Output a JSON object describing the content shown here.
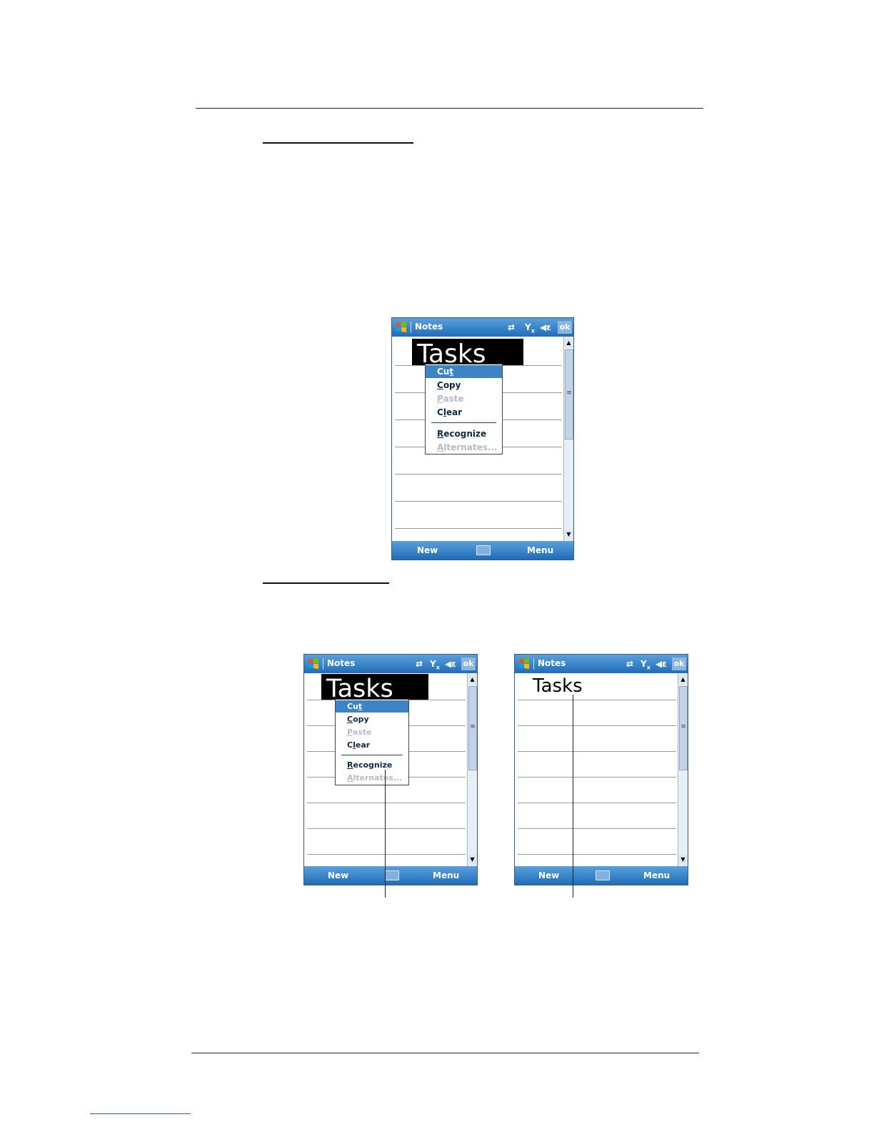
{
  "app": {
    "title": "Notes",
    "ok_label": "ok",
    "left_softkey": "New",
    "right_softkey": "Menu",
    "handwritten_word": "Tasks",
    "converted_text": "Tasks"
  },
  "context_menu": {
    "items": [
      {
        "label": "Cut",
        "accel": "t",
        "state": "selected"
      },
      {
        "label": "Copy",
        "accel": "C",
        "state": "enabled"
      },
      {
        "label": "Paste",
        "accel": "P",
        "state": "disabled"
      },
      {
        "label": "Clear",
        "accel": "l",
        "state": "enabled"
      },
      {
        "label": "Recognize",
        "accel": "R",
        "state": "enabled"
      },
      {
        "label": "Alternates...",
        "accel": "A",
        "state": "disabled"
      }
    ]
  },
  "icons": {
    "start": "windows-flag-icon",
    "connectivity": "sync-arrows-icon",
    "signal": "signal-off-icon",
    "speaker": "speaker-icon",
    "keyboard": "keyboard-icon"
  },
  "colors": {
    "bar_top": "#5aa0dc",
    "bar_bottom": "#1f6cb8",
    "menu_highlight": "#3d83c8"
  }
}
